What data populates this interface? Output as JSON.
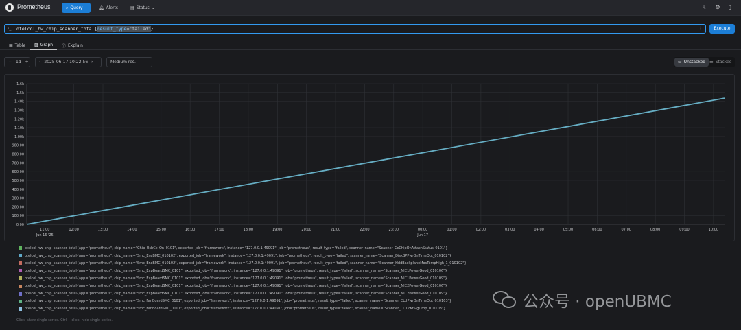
{
  "header": {
    "app_title": "Prometheus",
    "nav": [
      {
        "label": "Query",
        "icon": "search-icon",
        "active": true
      },
      {
        "label": "Alerts",
        "icon": "bell-icon",
        "active": false
      },
      {
        "label": "Status",
        "icon": "server-icon",
        "active": false
      }
    ],
    "status_chevron": "⌄",
    "icons": [
      "moon-icon",
      "gear-icon",
      "book-icon"
    ]
  },
  "query": {
    "metric": "otelcol_hw_chip_scanner_total",
    "open": "{",
    "label_name": "result_type",
    "op": "=",
    "label_value": "\"failed\"",
    "close": "}",
    "execute_label": "Execute"
  },
  "tabs": [
    {
      "label": "Table",
      "icon": "table-icon",
      "active": false
    },
    {
      "label": "Graph",
      "icon": "chart-icon",
      "active": true
    },
    {
      "label": "Explain",
      "icon": "info-icon",
      "active": false
    }
  ],
  "controls": {
    "range": "1d",
    "end_time": "2025-06-17 10:22:56",
    "resolution": "Medium res.",
    "minus": "−",
    "plus": "+",
    "prev": "‹",
    "next": "›",
    "unstacked": "Unstacked",
    "stacked": "Stacked"
  },
  "chart_data": {
    "type": "line",
    "y_ticks": [
      "0.00",
      "100.00",
      "200.00",
      "300.00",
      "400.00",
      "500.00",
      "600.00",
      "700.00",
      "800.00",
      "900.00",
      "1.00k",
      "1.10k",
      "1.20k",
      "1.30k",
      "1.40k",
      "1.5k",
      "1.6k"
    ],
    "ylim": [
      0,
      1600
    ],
    "x_ticks": [
      "11:00",
      "12:00",
      "13:00",
      "14:00",
      "15:00",
      "16:00",
      "17:00",
      "18:00",
      "19:00",
      "20:00",
      "21:00",
      "22:00",
      "23:00",
      "00:00",
      "01:00",
      "02:00",
      "03:00",
      "04:00",
      "05:00",
      "06:00",
      "07:00",
      "08:00",
      "09:00",
      "10:00"
    ],
    "x_day_labels": [
      {
        "tick": "11:00",
        "label": "Jun 16 '25"
      },
      {
        "tick": "00:00",
        "label": "Jun 17"
      }
    ],
    "x_range_hours": [
      10.38,
      34.38
    ],
    "series_points": [
      {
        "t": 10.38,
        "v": 0
      },
      {
        "t": 34.38,
        "v": 1435
      }
    ],
    "line_color": "#66aec4",
    "grid": true
  },
  "legend": {
    "items": [
      {
        "color": "#5fb35f",
        "text": "otelcol_hw_chip_scanner_total{app=\"prometheus\", chip_name=\"Chip_UsbCc_On_0101\", exported_job=\"framework\", instance=\"127.0.0.1:49091\", job=\"prometheus\", result_type=\"failed\", scanner_name=\"Scanner_CcChipOnAttachStatus_0101\"}"
      },
      {
        "color": "#5fa8c7",
        "text": "otelcol_hw_chip_scanner_total{app=\"prometheus\", chip_name=\"Smc_EncBMC_010102\", exported_job=\"framework\", instance=\"127.0.0.1:49091\", job=\"prometheus\", result_type=\"failed\", scanner_name=\"Scanner_DiskBPPwrOnTimeOut_010102\"}"
      },
      {
        "color": "#c26b5f",
        "text": "otelcol_hw_chip_scanner_total{app=\"prometheus\", chip_name=\"Smc_EncBMC_010102\", exported_job=\"framework\", instance=\"127.0.0.1:49091\", job=\"prometheus\", result_type=\"failed\", scanner_name=\"Scanner_HddBackplaneMosTempHigh_1_010102\"}"
      },
      {
        "color": "#b05fb3",
        "text": "otelcol_hw_chip_scanner_total{app=\"prometheus\", chip_name=\"Smc_ExpBoardSMC_0101\", exported_job=\"framework\", instance=\"127.0.0.1:49091\", job=\"prometheus\", result_type=\"failed\", scanner_name=\"Scanner_NIC1PowerGood_010106\"}"
      },
      {
        "color": "#b3b35f",
        "text": "otelcol_hw_chip_scanner_total{app=\"prometheus\", chip_name=\"Smc_ExpBoardSMC_0101\", exported_job=\"framework\", instance=\"127.0.0.1:49091\", job=\"prometheus\", result_type=\"failed\", scanner_name=\"Scanner_NIC1PowerGood_010109\"}"
      },
      {
        "color": "#c7855f",
        "text": "otelcol_hw_chip_scanner_total{app=\"prometheus\", chip_name=\"Smc_ExpBoardSMC_0101\", exported_job=\"framework\", instance=\"127.0.0.1:49091\", job=\"prometheus\", result_type=\"failed\", scanner_name=\"Scanner_NIC2PowerGood_010106\"}"
      },
      {
        "color": "#6f6fc7",
        "text": "otelcol_hw_chip_scanner_total{app=\"prometheus\", chip_name=\"Smc_ExpBoardSMC_0101\", exported_job=\"framework\", instance=\"127.0.0.1:49091\", job=\"prometheus\", result_type=\"failed\", scanner_name=\"Scanner_NIC2PowerGood_010109\"}"
      },
      {
        "color": "#5fb385",
        "text": "otelcol_hw_chip_scanner_total{app=\"prometheus\", chip_name=\"Smc_FanBoardSMC_0101\", exported_job=\"framework\", instance=\"127.0.0.1:49091\", job=\"prometheus\", result_type=\"failed\", scanner_name=\"Scanner_CLUPwrOnTimeOut_010103\"}"
      },
      {
        "color": "#8fc0e0",
        "text": "otelcol_hw_chip_scanner_total{app=\"prometheus\", chip_name=\"Smc_FanBoardSMC_0101\", exported_job=\"framework\", instance=\"127.0.0.1:49091\", job=\"prometheus\", result_type=\"failed\", scanner_name=\"Scanner_CLUPwrSigDrop_010103\"}"
      }
    ],
    "hint": "Click: show single series. Ctrl + click: hide single series."
  },
  "watermark": {
    "text": "公众号 · openUBMC",
    "icon": "wechat-icon"
  }
}
